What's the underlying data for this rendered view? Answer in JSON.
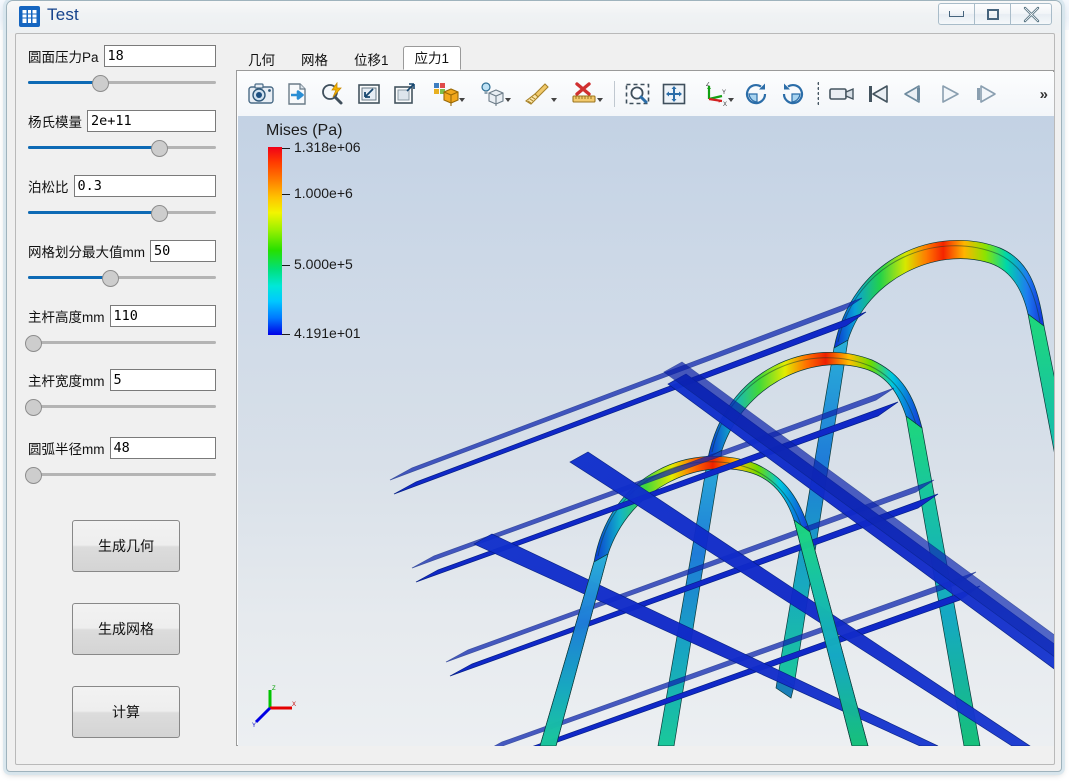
{
  "window": {
    "title": "Test",
    "app_icon": "app-window-icon",
    "buttons": {
      "minimize": "minimize-icon",
      "maximize": "maximize-icon",
      "close": "close-icon"
    }
  },
  "params": [
    {
      "label": "圆面压力Pa",
      "value": "18",
      "slider": 38,
      "name": "surface-pressure"
    },
    {
      "label": "杨氏模量",
      "value": "2e+11",
      "slider": 69,
      "name": "youngs-modulus"
    },
    {
      "label": "泊松比",
      "value": "0.3",
      "slider": 69,
      "name": "poisson-ratio"
    },
    {
      "label": "网格划分最大值mm",
      "value": "50",
      "slider": 43,
      "name": "mesh-max-size"
    },
    {
      "label": "主杆高度mm",
      "value": "110",
      "slider": 0,
      "name": "bar-height"
    },
    {
      "label": "主杆宽度mm",
      "value": "5",
      "slider": 0,
      "name": "bar-width"
    },
    {
      "label": "圆弧半径mm",
      "value": "48",
      "slider": 0,
      "name": "arc-radius"
    }
  ],
  "actions": [
    {
      "label": "生成几何",
      "name": "generate-geometry-button"
    },
    {
      "label": "生成网格",
      "name": "generate-mesh-button"
    },
    {
      "label": "计算",
      "name": "compute-button"
    }
  ],
  "tabs": [
    {
      "label": "几何",
      "active": false,
      "name": "tab-geometry"
    },
    {
      "label": "网格",
      "active": false,
      "name": "tab-mesh"
    },
    {
      "label": "位移1",
      "active": false,
      "name": "tab-displacement-1"
    },
    {
      "label": "应力1",
      "active": true,
      "name": "tab-stress-1"
    }
  ],
  "toolbar": {
    "overflow_label": "»",
    "items": [
      {
        "name": "screenshot-icon",
        "dropdown": false
      },
      {
        "name": "export-icon",
        "dropdown": false
      },
      {
        "name": "zoom-auto-icon",
        "dropdown": false
      },
      {
        "name": "fit-window-icon",
        "dropdown": false
      },
      {
        "name": "zoom-to-box-icon",
        "dropdown": false
      },
      {
        "name": "edit-color-map-icon",
        "dropdown": true
      },
      {
        "name": "lighting-icon",
        "dropdown": true
      },
      {
        "name": "clear-icon",
        "dropdown": true
      },
      {
        "name": "scalar-bar-icon",
        "dropdown": true
      },
      {
        "name": "zoom-selection-icon",
        "dropdown": false
      },
      {
        "name": "pan-icon",
        "dropdown": false
      },
      {
        "name": "camera-orientation-icon",
        "dropdown": true
      },
      {
        "name": "rotate-cw-icon",
        "dropdown": false
      },
      {
        "name": "rotate-ccw-icon",
        "dropdown": false
      },
      {
        "name": "animation-icon",
        "dropdown": false
      },
      {
        "name": "first-frame-icon",
        "dropdown": false
      },
      {
        "name": "previous-frame-icon",
        "dropdown": false
      },
      {
        "name": "play-icon",
        "dropdown": false
      },
      {
        "name": "next-frame-icon",
        "dropdown": false
      }
    ]
  },
  "chart_data": {
    "type": "heatmap",
    "title": "Mises (Pa)",
    "colormap": "rainbow-jet",
    "legend_position": "left",
    "vmin": 41.91,
    "vmax": 1318000,
    "ticks": [
      {
        "label": "1.318e+06",
        "value": 1318000,
        "pos_pct": 0
      },
      {
        "label": "1.000e+6",
        "value": 1000000,
        "pos_pct": 24.2
      },
      {
        "label": "5.000e+5",
        "value": 500000,
        "pos_pct": 62.1
      },
      {
        "label": "4.191e+01",
        "value": 41.91,
        "pos_pct": 100
      }
    ],
    "axis_triad": {
      "x": "X",
      "y": "Y",
      "z": "Z"
    }
  }
}
